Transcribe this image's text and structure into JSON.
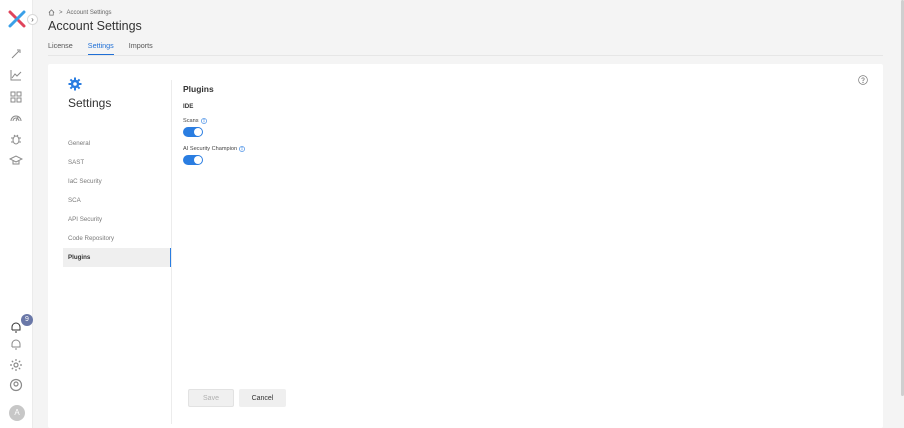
{
  "rail": {
    "toggle_glyph": "›",
    "icons": [
      "rocket-icon",
      "line-chart-icon",
      "dashboard-icon",
      "radar-icon",
      "bug-icon",
      "graduation-cap-icon"
    ],
    "bottom_icons": [
      "notifications-bell-icon",
      "alerts-bell-icon",
      "settings-gear-icon",
      "user-circle-icon"
    ],
    "notification_count": "9",
    "avatar_initial": "A",
    "logo_colors": {
      "primary": "#e0445b",
      "secondary": "#3aa0e8"
    }
  },
  "breadcrumb": {
    "home_icon": "home-icon",
    "separator": ">",
    "current": "Account Settings"
  },
  "page_title": "Account Settings",
  "tabs": [
    {
      "label": "License",
      "active": false
    },
    {
      "label": "Settings",
      "active": true
    },
    {
      "label": "Imports",
      "active": false
    }
  ],
  "settings_panel": {
    "heading": "Settings",
    "nav": [
      {
        "label": "General",
        "active": false
      },
      {
        "label": "SAST",
        "active": false
      },
      {
        "label": "IaC Security",
        "active": false
      },
      {
        "label": "SCA",
        "active": false
      },
      {
        "label": "API Security",
        "active": false
      },
      {
        "label": "Code Repository",
        "active": false
      },
      {
        "label": "Plugins",
        "active": true
      }
    ]
  },
  "plugins": {
    "title": "Plugins",
    "section": "IDE",
    "options": [
      {
        "label": "Scans",
        "enabled": true
      },
      {
        "label": "AI Security Champion",
        "enabled": true
      }
    ]
  },
  "actions": {
    "save_label": "Save",
    "cancel_label": "Cancel"
  },
  "colors": {
    "accent": "#2a7de1",
    "active_tab": "#1f6fd6",
    "badge": "#6a78a8"
  }
}
